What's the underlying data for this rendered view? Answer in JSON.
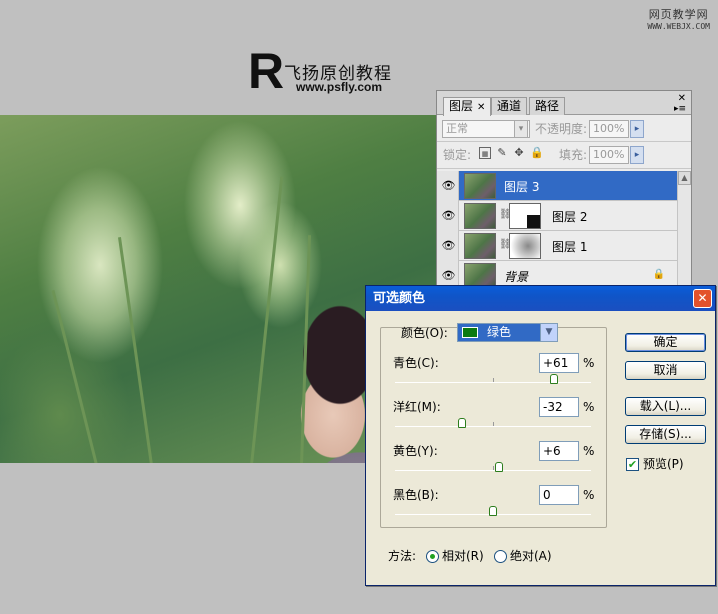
{
  "watermark": {
    "line1": "网页教学网",
    "line2": "WWW.WEBJX.COM"
  },
  "logo": {
    "letter": "R",
    "title": "飞扬原创教程",
    "url": "www.psfly.com"
  },
  "layers_panel": {
    "tabs": [
      {
        "label": "图层",
        "active": true
      },
      {
        "label": "通道",
        "active": false
      },
      {
        "label": "路径",
        "active": false
      }
    ],
    "blend_mode": "正常",
    "opacity_label": "不透明度:",
    "opacity_value": "100%",
    "lock_label": "锁定:",
    "fill_label": "填充:",
    "fill_value": "100%",
    "layers": [
      {
        "name": "图层 3",
        "selected": true,
        "has_mask": false
      },
      {
        "name": "图层 2",
        "selected": false,
        "has_mask": true
      },
      {
        "name": "图层 1",
        "selected": false,
        "has_mask": true
      },
      {
        "name": "背景",
        "selected": false,
        "has_mask": false,
        "locked": true
      }
    ]
  },
  "dialog": {
    "title": "可选颜色",
    "color_label": "颜色(O):",
    "color_value": "绿色",
    "color_swatch": "#0c7a10",
    "sliders": [
      {
        "label": "青色(C):",
        "value": "+61",
        "unit": "%",
        "percent": 61
      },
      {
        "label": "洋红(M):",
        "value": "-32",
        "unit": "%",
        "percent": -32
      },
      {
        "label": "黄色(Y):",
        "value": "+6",
        "unit": "%",
        "percent": 6
      },
      {
        "label": "黑色(B):",
        "value": "0",
        "unit": "%",
        "percent": 0
      }
    ],
    "buttons": {
      "ok": "确定",
      "cancel": "取消",
      "load": "载入(L)...",
      "save": "存储(S)..."
    },
    "preview_label": "预览(P)",
    "preview_checked": true,
    "method_label": "方法:",
    "method_relative": "相对(R)",
    "method_absolute": "绝对(A)",
    "method_selected": "relative"
  }
}
